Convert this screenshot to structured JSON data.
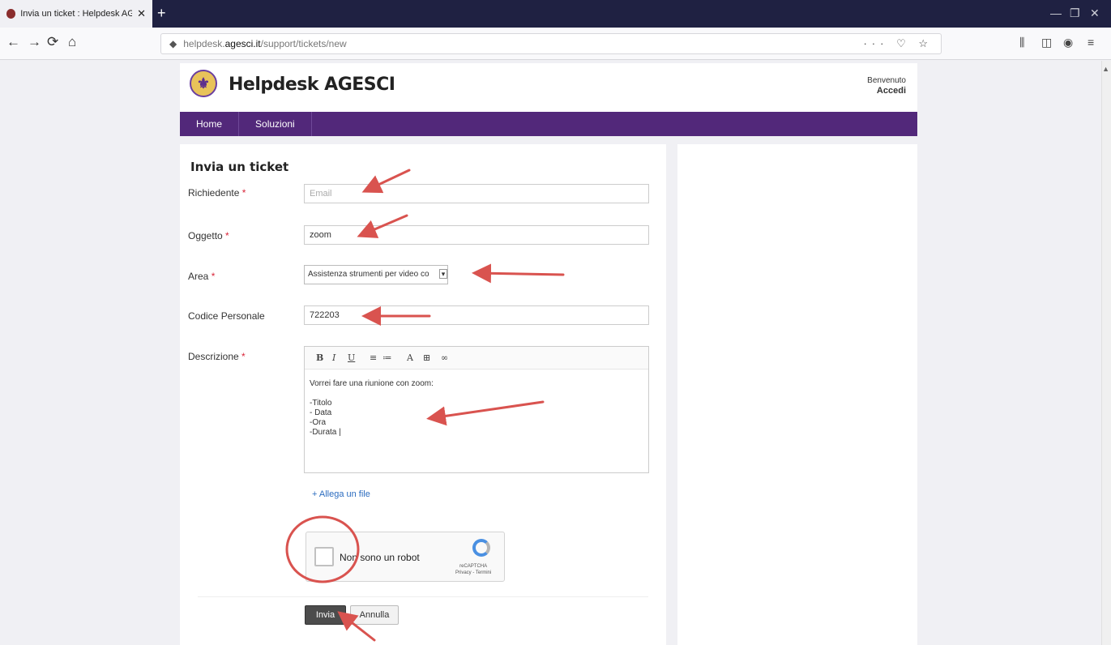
{
  "browser": {
    "tab_title": "Invia un ticket : Helpdesk AGES",
    "tab_close": "✕",
    "new_tab": "+",
    "url_prefix": "helpdesk.",
    "url_host": "agesci.it",
    "url_path": "/support/tickets/new",
    "url_actions": "··· ♡ ☆",
    "window_controls": [
      "—",
      "❐",
      "✕"
    ],
    "nav": {
      "back": "←",
      "forward": "→",
      "reload": "⟳",
      "home": "⌂"
    }
  },
  "site": {
    "title": "Helpdesk AGESCI",
    "welcome": "Benvenuto",
    "login": "Accedi",
    "menu": [
      "Home",
      "Soluzioni"
    ]
  },
  "form": {
    "title": "Invia un ticket",
    "required_mark": "*",
    "fields": {
      "requester": {
        "label": "Richiedente",
        "placeholder": "Email"
      },
      "subject": {
        "label": "Oggetto",
        "value": "zoom"
      },
      "area": {
        "label": "Area",
        "value": "Assistenza strumenti per video co"
      },
      "personal_code": {
        "label": "Codice Personale",
        "value": "722203"
      },
      "description": {
        "label": "Descrizione",
        "toolbar": [
          "B",
          "I",
          "U",
          "≡",
          "≔",
          "A",
          "⊞",
          "∞"
        ],
        "text": "Vorrei fare una riunione con zoom:\n\n-Titolo\n- Data\n-Ora\n-Durata |"
      }
    },
    "attach_label": "+ Allega un file",
    "captcha": {
      "label": "Non sono un robot",
      "brand": "reCAPTCHA",
      "links": "Privacy - Termini"
    },
    "submit_label": "Invia",
    "cancel_label": "Annulla"
  },
  "colors": {
    "brand_purple": "#52287a",
    "annotation_red": "#d9534f"
  }
}
